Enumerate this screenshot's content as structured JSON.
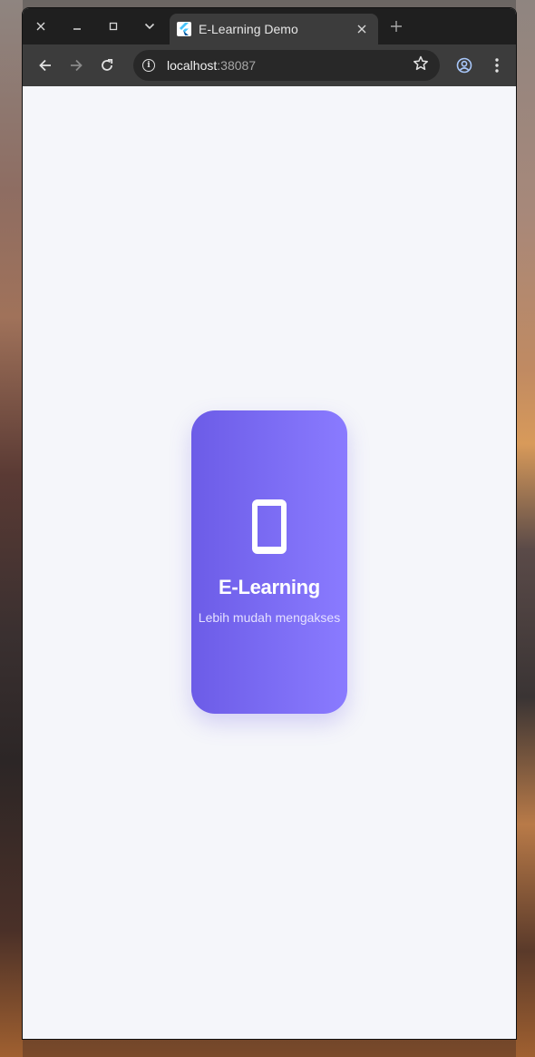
{
  "browser": {
    "tab_title": "E-Learning Demo",
    "url_host": "localhost",
    "url_port": ":38087",
    "icons": {
      "close_window": "close-icon",
      "minimize": "minimize-icon",
      "maximize": "maximize-icon",
      "tab_list": "chevron-down-icon",
      "tab_close": "close-icon",
      "new_tab": "plus-icon",
      "back": "arrow-left-icon",
      "forward": "arrow-right-icon",
      "reload": "reload-icon",
      "site_info": "info-icon",
      "bookmark": "star-icon",
      "profile": "profile-icon",
      "menu": "kebab-menu-icon"
    }
  },
  "app": {
    "title": "E-Learning",
    "subtitle": "Lebih mudah mengakses",
    "icon": "smartphone-icon",
    "colors": {
      "background": "#f5f6fa",
      "gradient_start": "#6c5ce7",
      "gradient_end": "#8a7bff",
      "text": "#ffffff"
    }
  }
}
